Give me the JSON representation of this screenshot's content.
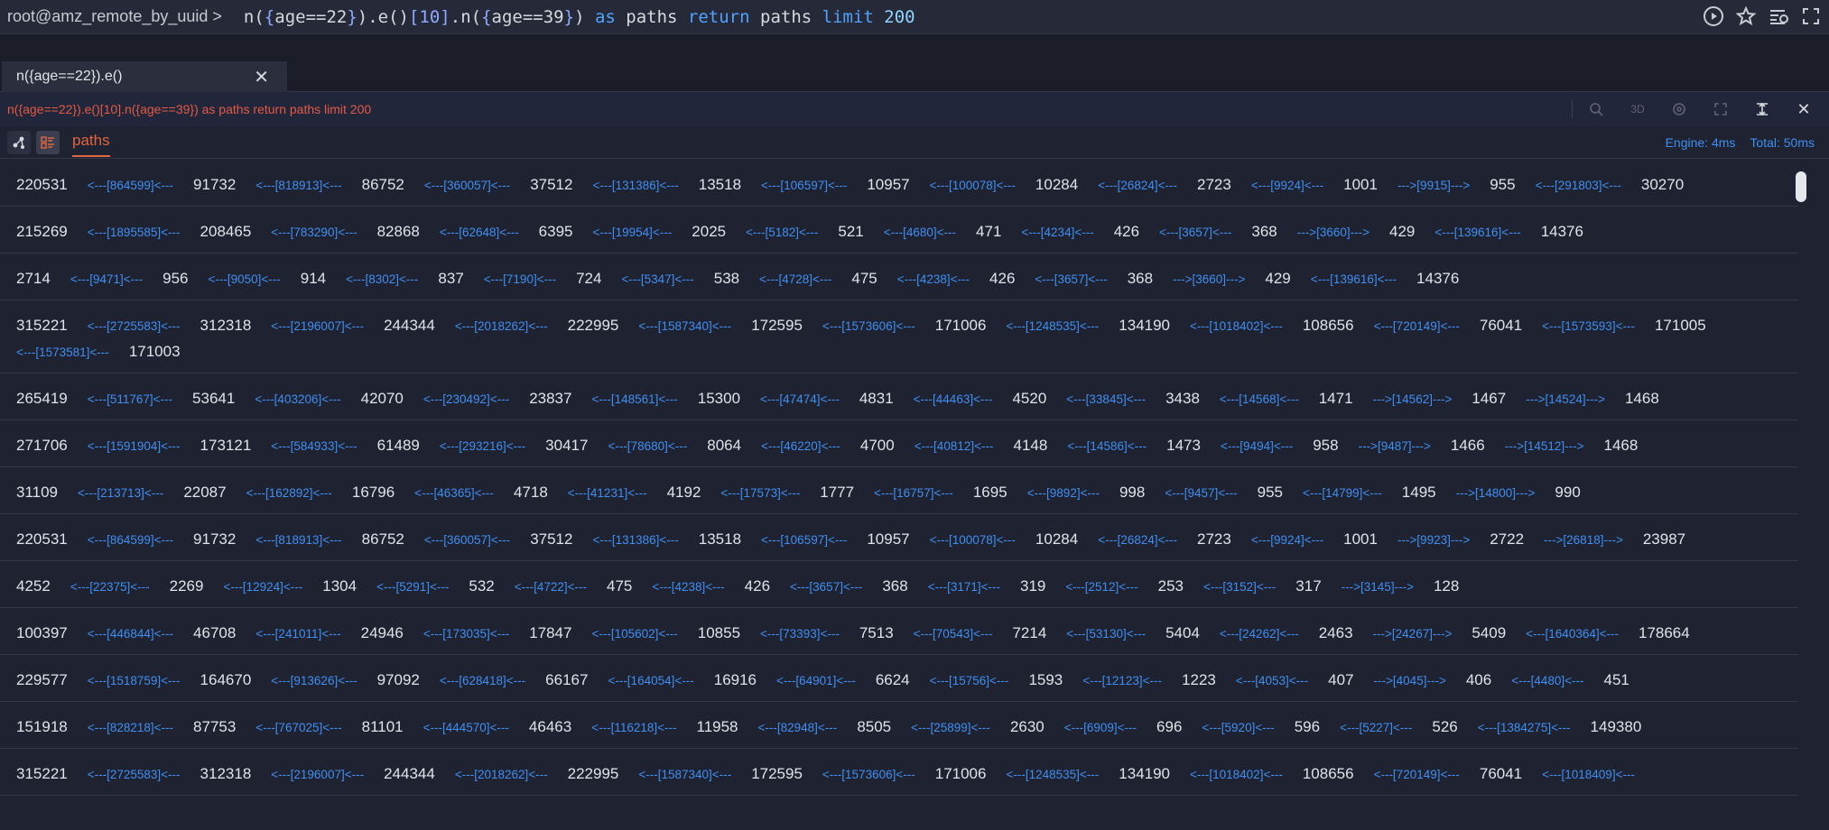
{
  "topbar": {
    "prompt": "root@amz_remote_by_uuid >",
    "query_parts": [
      {
        "t": "n(",
        "c": "plain"
      },
      {
        "t": "{",
        "c": "brace"
      },
      {
        "t": "age==22",
        "c": "plain"
      },
      {
        "t": "}",
        "c": "brace"
      },
      {
        "t": ").e()",
        "c": "plain"
      },
      {
        "t": "[10]",
        "c": "brace"
      },
      {
        "t": ".n(",
        "c": "plain"
      },
      {
        "t": "{",
        "c": "brace"
      },
      {
        "t": "age==39",
        "c": "plain"
      },
      {
        "t": "}",
        "c": "brace"
      },
      {
        "t": ") ",
        "c": "plain"
      },
      {
        "t": "as",
        "c": "kw"
      },
      {
        "t": " paths ",
        "c": "plain"
      },
      {
        "t": "return",
        "c": "kw"
      },
      {
        "t": " paths ",
        "c": "plain"
      },
      {
        "t": "limit",
        "c": "kw"
      },
      {
        "t": " 200",
        "c": "num"
      }
    ],
    "icons": [
      "run-icon",
      "star-icon",
      "history-icon",
      "fullscreen-icon"
    ]
  },
  "tab": {
    "label": "n({age==22}).e()",
    "close": "✕"
  },
  "result": {
    "query": "n({age==22}).e()[10].n({age==39}) as paths return paths limit 200",
    "tools": [
      "search-icon",
      "3D",
      "graph-settings-icon",
      "expand-icon",
      "split-icon",
      "close-icon"
    ],
    "tools_3d_label": "3D",
    "close_label": "✕"
  },
  "view": {
    "tab_label": "paths",
    "engine": "Engine: 4ms",
    "total": "Total: 50ms"
  },
  "rows": [
    [
      "220531",
      "<---[864599]<---",
      "91732",
      "<---[818913]<---",
      "86752",
      "<---[360057]<---",
      "37512",
      "<---[131386]<---",
      "13518",
      "<---[106597]<---",
      "10957",
      "<---[100078]<---",
      "10284",
      "<---[26824]<---",
      "2723",
      "<---[9924]<---",
      "1001",
      "--->[9915]--->",
      "955",
      "<---[291803]<---",
      "30270"
    ],
    [
      "215269",
      "<---[1895585]<---",
      "208465",
      "<---[783290]<---",
      "82868",
      "<---[62648]<---",
      "6395",
      "<---[19954]<---",
      "2025",
      "<---[5182]<---",
      "521",
      "<---[4680]<---",
      "471",
      "<---[4234]<---",
      "426",
      "<---[3657]<---",
      "368",
      "--->[3660]--->",
      "429",
      "<---[139616]<---",
      "14376"
    ],
    [
      "2714",
      "<---[9471]<---",
      "956",
      "<---[9050]<---",
      "914",
      "<---[8302]<---",
      "837",
      "<---[7190]<---",
      "724",
      "<---[5347]<---",
      "538",
      "<---[4728]<---",
      "475",
      "<---[4238]<---",
      "426",
      "<---[3657]<---",
      "368",
      "--->[3660]--->",
      "429",
      "<---[139616]<---",
      "14376"
    ],
    [
      "315221",
      "<---[2725583]<---",
      "312318",
      "<---[2196007]<---",
      "244344",
      "<---[2018262]<---",
      "222995",
      "<---[1587340]<---",
      "172595",
      "<---[1573606]<---",
      "171006",
      "<---[1248535]<---",
      "134190",
      "<---[1018402]<---",
      "108656",
      "<---[720149]<---",
      "76041",
      "<---[1573593]<---",
      "171005",
      "<---[1573581]<---",
      "171003"
    ],
    [
      "265419",
      "<---[511767]<---",
      "53641",
      "<---[403206]<---",
      "42070",
      "<---[230492]<---",
      "23837",
      "<---[148561]<---",
      "15300",
      "<---[47474]<---",
      "4831",
      "<---[44463]<---",
      "4520",
      "<---[33845]<---",
      "3438",
      "<---[14568]<---",
      "1471",
      "--->[14562]--->",
      "1467",
      "--->[14524]--->",
      "1468"
    ],
    [
      "271706",
      "<---[1591904]<---",
      "173121",
      "<---[584933]<---",
      "61489",
      "<---[293216]<---",
      "30417",
      "<---[78680]<---",
      "8064",
      "<---[46220]<---",
      "4700",
      "<---[40812]<---",
      "4148",
      "<---[14586]<---",
      "1473",
      "<---[9494]<---",
      "958",
      "--->[9487]--->",
      "1466",
      "--->[14512]--->",
      "1468"
    ],
    [
      "31109",
      "<---[213713]<---",
      "22087",
      "<---[162892]<---",
      "16796",
      "<---[46365]<---",
      "4718",
      "<---[41231]<---",
      "4192",
      "<---[17573]<---",
      "1777",
      "<---[16757]<---",
      "1695",
      "<---[9892]<---",
      "998",
      "<---[9457]<---",
      "955",
      "<---[14799]<---",
      "1495",
      "--->[14800]--->",
      "990"
    ],
    [
      "220531",
      "<---[864599]<---",
      "91732",
      "<---[818913]<---",
      "86752",
      "<---[360057]<---",
      "37512",
      "<---[131386]<---",
      "13518",
      "<---[106597]<---",
      "10957",
      "<---[100078]<---",
      "10284",
      "<---[26824]<---",
      "2723",
      "<---[9924]<---",
      "1001",
      "--->[9923]--->",
      "2722",
      "--->[26818]--->",
      "23987"
    ],
    [
      "4252",
      "<---[22375]<---",
      "2269",
      "<---[12924]<---",
      "1304",
      "<---[5291]<---",
      "532",
      "<---[4722]<---",
      "475",
      "<---[4238]<---",
      "426",
      "<---[3657]<---",
      "368",
      "<---[3171]<---",
      "319",
      "<---[2512]<---",
      "253",
      "<---[3152]<---",
      "317",
      "--->[3145]--->",
      "128"
    ],
    [
      "100397",
      "<---[446844]<---",
      "46708",
      "<---[241011]<---",
      "24946",
      "<---[173035]<---",
      "17847",
      "<---[105602]<---",
      "10855",
      "<---[73393]<---",
      "7513",
      "<---[70543]<---",
      "7214",
      "<---[53130]<---",
      "5404",
      "<---[24262]<---",
      "2463",
      "--->[24267]--->",
      "5409",
      "<---[1640364]<---",
      "178664"
    ],
    [
      "229577",
      "<---[1518759]<---",
      "164670",
      "<---[913626]<---",
      "97092",
      "<---[628418]<---",
      "66167",
      "<---[164054]<---",
      "16916",
      "<---[64901]<---",
      "6624",
      "<---[15756]<---",
      "1593",
      "<---[12123]<---",
      "1223",
      "<---[4053]<---",
      "407",
      "--->[4045]--->",
      "406",
      "<---[4480]<---",
      "451"
    ],
    [
      "151918",
      "<---[828218]<---",
      "87753",
      "<---[767025]<---",
      "81101",
      "<---[444570]<---",
      "46463",
      "<---[116218]<---",
      "11958",
      "<---[82948]<---",
      "8505",
      "<---[25899]<---",
      "2630",
      "<---[6909]<---",
      "696",
      "<---[5920]<---",
      "596",
      "<---[5227]<---",
      "526",
      "<---[1384275]<---",
      "149380"
    ],
    [
      "315221",
      "<---[2725583]<---",
      "312318",
      "<---[2196007]<---",
      "244344",
      "<---[2018262]<---",
      "222995",
      "<---[1587340]<---",
      "172595",
      "<---[1573606]<---",
      "171006",
      "<---[1248535]<---",
      "134190",
      "<---[1018402]<---",
      "108656",
      "<---[720149]<---",
      "76041",
      "<---[1018409]<---"
    ]
  ]
}
